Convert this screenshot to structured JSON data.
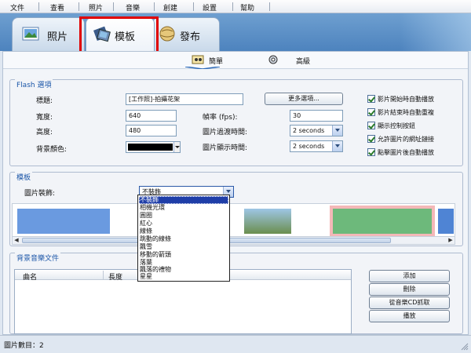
{
  "menu": [
    "文件",
    "查看",
    "照片",
    "音樂",
    "創建",
    "設置",
    "幫助"
  ],
  "tabs": {
    "photo": "照片",
    "template": "模板",
    "publish": "發布"
  },
  "subtabs": {
    "simple": "簡單",
    "advanced": "高級"
  },
  "flash": {
    "section_title": "Flash 選項",
    "title_label": "標題:",
    "title_value": "[工作照]-拍攝花架",
    "more_options": "更多選項...",
    "width_label": "寬度:",
    "width_value": "640",
    "height_label": "高度:",
    "height_value": "480",
    "bgcolor_label": "背景顏色:",
    "bgcolor": "#000000",
    "fps_label": "幀率 (fps):",
    "fps_value": "30",
    "transition_label": "圖片過渡時間:",
    "transition_value": "2 seconds",
    "display_label": "圖片顯示時間:",
    "display_value": "2 seconds",
    "checkboxes": [
      {
        "label": "影片開始時自動播放",
        "checked": true
      },
      {
        "label": "影片結束時自動重複",
        "checked": true
      },
      {
        "label": "顯示控制按鈕",
        "checked": true
      },
      {
        "label": "允許圖片的網址鏈接",
        "checked": true
      },
      {
        "label": "點擊圖片後自動播放",
        "checked": true
      }
    ]
  },
  "template_section": {
    "title": "模板",
    "decoration_label": "圖片裝飾:",
    "decoration_value": "不裝飾",
    "options": [
      "不裝飾",
      "相機光環",
      "圓圈",
      "紅心",
      "線條",
      "跳動的線條",
      "飄雪",
      "移動的箭頭",
      "落葉",
      "飄落的禮物",
      "星星"
    ]
  },
  "music": {
    "section_title": "背景音樂文件",
    "col_name": "曲名",
    "col_length": "長度",
    "add": "添加",
    "delete": "刪除",
    "rip_cd": "從音樂CD抓取",
    "play": "播放"
  },
  "status": {
    "photo_count": "圖片數目：2"
  },
  "colors": {
    "tabstrip": "#5a8fc8",
    "section_title": "#1b56a8",
    "highlight_box": "#e00000",
    "selection": "#1f3ea8"
  }
}
